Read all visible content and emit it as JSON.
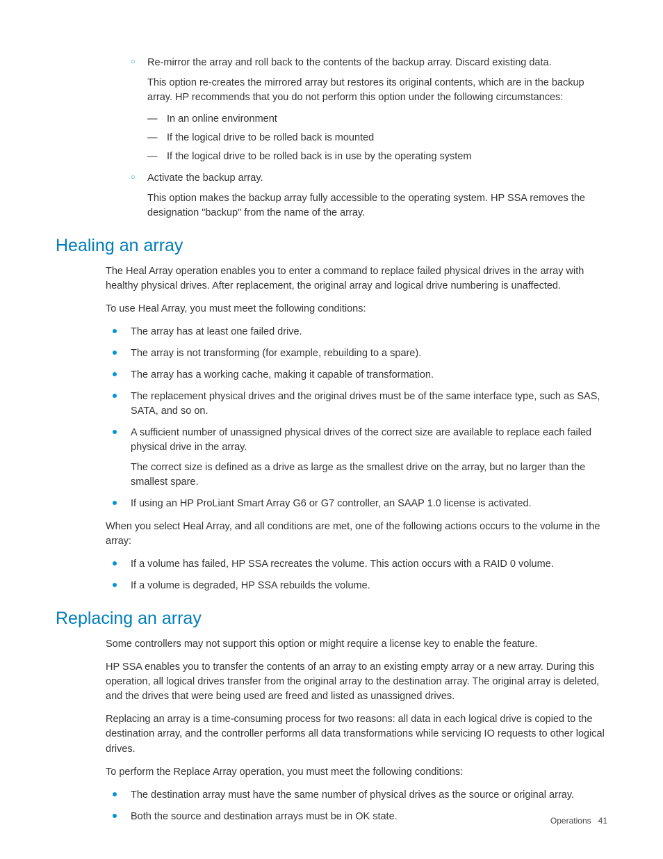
{
  "topList": {
    "item1": {
      "title": "Re-mirror the array and roll back to the contents of the backup array. Discard existing data.",
      "para": "This option re-creates the mirrored array but restores its original contents, which are in the backup array. HP recommends that you do not perform this option under the following circumstances:",
      "dashes": [
        "In an online environment",
        "If the logical drive to be rolled back is mounted",
        "If the logical drive to be rolled back is in use by the operating system"
      ]
    },
    "item2": {
      "title": "Activate the backup array.",
      "para": "This option makes the backup array fully accessible to the operating system. HP SSA removes the designation \"backup\" from the name of the array."
    }
  },
  "healing": {
    "heading": "Healing an array",
    "para1": "The Heal Array operation enables you to enter a command to replace failed physical drives in the array with healthy physical drives. After replacement, the original array and logical drive numbering is unaffected.",
    "para2": "To use Heal Array, you must meet the following conditions:",
    "conditions": [
      {
        "text": "The array has at least one failed drive."
      },
      {
        "text": "The array is not transforming (for example, rebuilding to a spare)."
      },
      {
        "text": "The array has a working cache, making it capable of transformation."
      },
      {
        "text": "The replacement physical drives and the original drives must be of the same interface type, such as SAS, SATA, and so on."
      },
      {
        "text": "A sufficient number of unassigned physical drives of the correct size are available to replace each failed physical drive in the array.",
        "follow": "The correct size is defined as a drive as large as the smallest drive on the array, but no larger than the smallest spare."
      },
      {
        "text": "If using an HP ProLiant Smart Array G6 or G7 controller, an SAAP 1.0 license is activated."
      }
    ],
    "para3": "When you select Heal Array, and all conditions are met, one of the following actions occurs to the volume in the array:",
    "actions": [
      "If a volume has failed, HP SSA recreates the volume. This action occurs with a RAID 0 volume.",
      "If a volume is degraded, HP SSA rebuilds the volume."
    ]
  },
  "replacing": {
    "heading": "Replacing an array",
    "para1": "Some controllers may not support this option or might require a license key to enable the feature.",
    "para2": "HP SSA enables you to transfer the contents of an array to an existing empty array or a new array. During this operation, all logical drives transfer from the original array to the destination array. The original array is deleted, and the drives that were being used are freed and listed as unassigned drives.",
    "para3": "Replacing an array is a time-consuming process for two reasons: all data in each logical drive is copied to the destination array, and the controller performs all data transformations while servicing IO requests to other logical drives.",
    "para4": "To perform the Replace Array operation, you must meet the following conditions:",
    "conditions": [
      "The destination array must have the same number of physical drives as the source or original array.",
      "Both the source and destination arrays must be in OK state."
    ]
  },
  "footer": {
    "section": "Operations",
    "page": "41"
  }
}
